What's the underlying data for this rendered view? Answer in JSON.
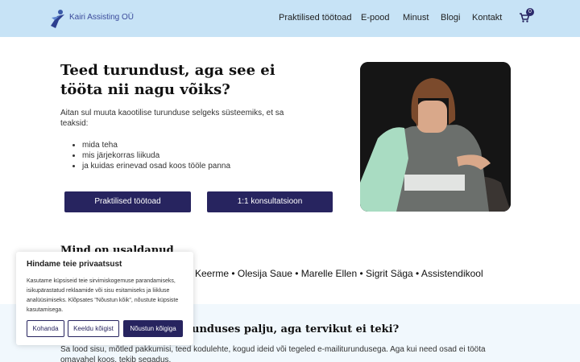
{
  "header": {
    "brand": "Kairi Assisting OÜ",
    "nav": [
      "Praktilised töötoad",
      "E-pood",
      "Minust",
      "Blogi",
      "Kontakt"
    ],
    "cart_count": "0"
  },
  "hero": {
    "title": "Teed turundust, aga see ei tööta nii nagu võiks?",
    "intro": "Aitan sul muuta kaootilise turunduse selgeks süsteemiks, et sa teaksid:",
    "bullets": [
      "mida teha",
      "mis järjekorras liikuda",
      "ja kuidas erinevad osad koos tööle panna"
    ],
    "buttons": [
      "Praktilised töötoad",
      "1:1 konsultatsioon"
    ]
  },
  "trusted": {
    "title": "Mind on usaldanud",
    "names": "Keerme • Olesija Saue • Marelle Ellen • Sigrit Säga • Assistendikool"
  },
  "lower": {
    "title": "unduses palju, aga tervikut ei teki?",
    "text": "Sa lood sisu, mõtled pakkumisi, teed kodulehte, kogud ideid või tegeled e-mailiturundusega. Aga kui need osad ei tööta omavahel koos, tekib segadus."
  },
  "cookie": {
    "title": "Hindame teie privaatsust",
    "text": "Kasutame küpsiseid teie sirvimiskogemuse parandamiseks, isikupärastatud reklaamide või sisu esitamiseks ja liikluse analüüsimiseks. Klõpsates \"Nõustun kõik\", nõustute küpsiste kasutamisega.",
    "buttons": [
      "Kohanda",
      "Keeldu kõigist",
      "Nõustun kõigiga"
    ]
  },
  "colors": {
    "header_bg": "#c7e3f6",
    "primary": "#27245f",
    "lower_bg": "#f1f8fd"
  }
}
